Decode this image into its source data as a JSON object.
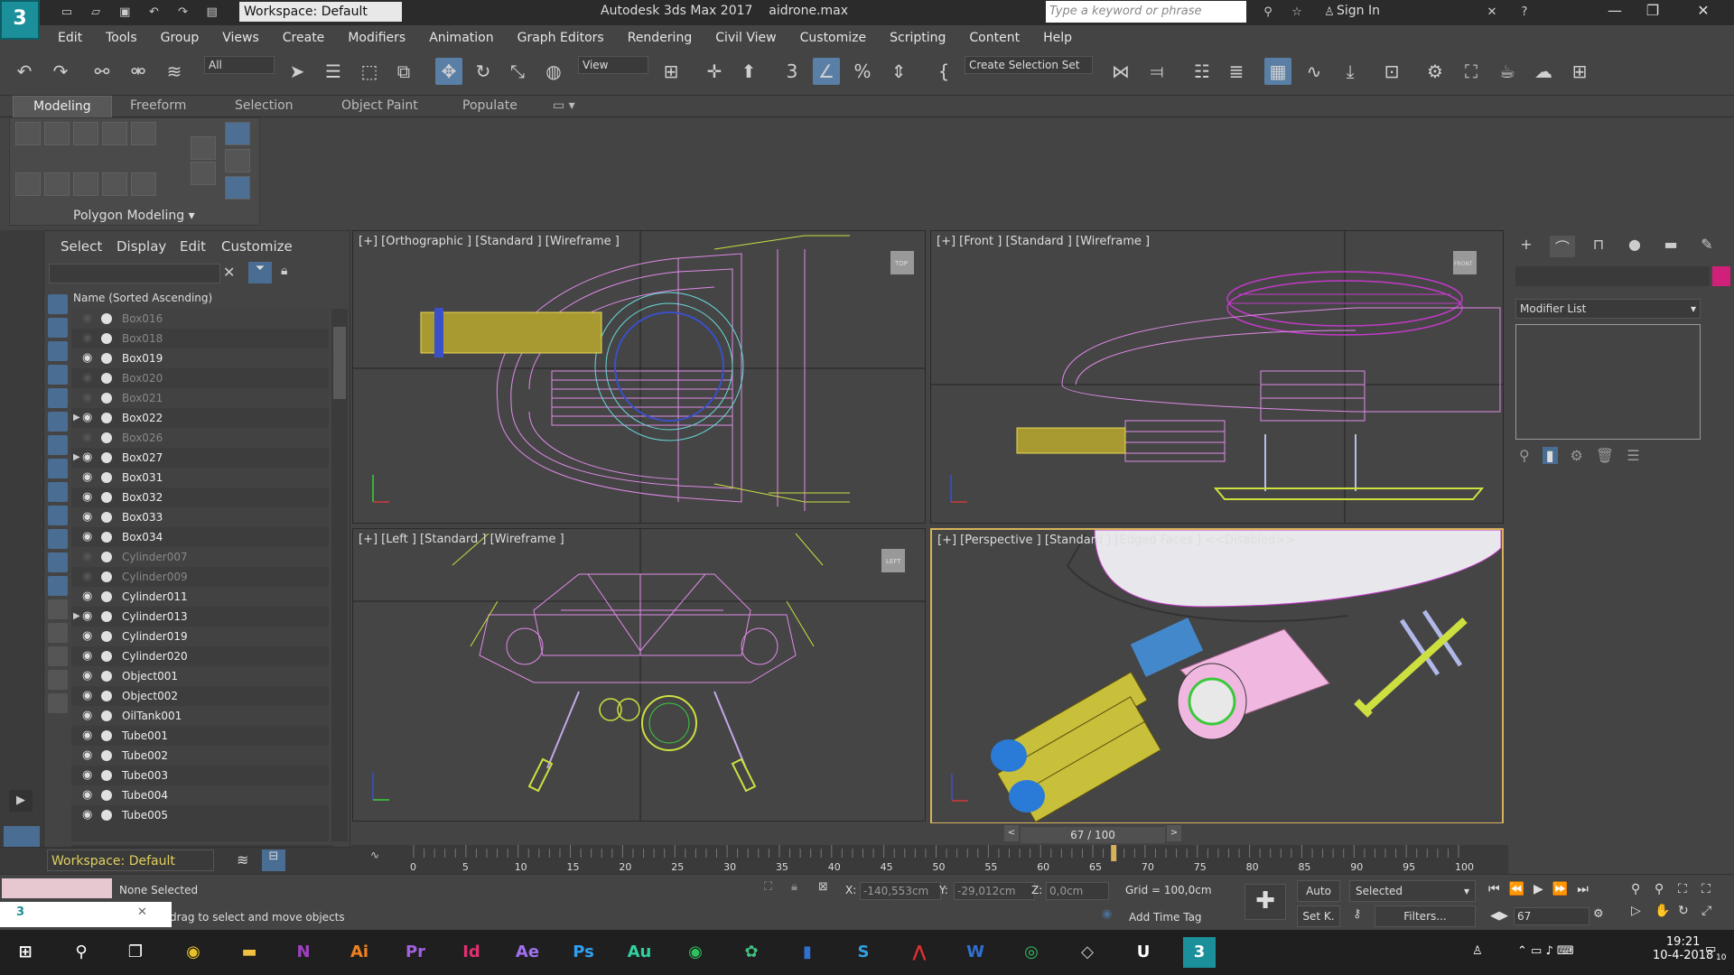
{
  "titlebar": {
    "logo": "3",
    "workspace": "Workspace: Default",
    "app_title": "Autodesk 3ds Max 2017",
    "file_name": "aidrone.max",
    "search_placeholder": "Type a keyword or phrase",
    "signin": "Sign In"
  },
  "menus": [
    "Edit",
    "Tools",
    "Group",
    "Views",
    "Create",
    "Modifiers",
    "Animation",
    "Graph Editors",
    "Rendering",
    "Civil View",
    "Customize",
    "Scripting",
    "Content",
    "Help"
  ],
  "toolbar": {
    "selection_filter": "All",
    "ref_coord": "View",
    "selection_set": "Create Selection Set"
  },
  "ribbon": {
    "tabs": [
      "Modeling",
      "Freeform",
      "Selection",
      "Object Paint",
      "Populate"
    ],
    "panel_label": "Polygon Modeling ▾"
  },
  "explorer": {
    "menus": [
      "Select",
      "Display",
      "Edit",
      "Customize"
    ],
    "header": "Name (Sorted Ascending)",
    "items": [
      {
        "name": "Box016",
        "hidden": true,
        "expand": false
      },
      {
        "name": "Box018",
        "hidden": true,
        "expand": false
      },
      {
        "name": "Box019",
        "hidden": false,
        "expand": false
      },
      {
        "name": "Box020",
        "hidden": true,
        "expand": false
      },
      {
        "name": "Box021",
        "hidden": true,
        "expand": false
      },
      {
        "name": "Box022",
        "hidden": false,
        "expand": true
      },
      {
        "name": "Box026",
        "hidden": true,
        "expand": false
      },
      {
        "name": "Box027",
        "hidden": false,
        "expand": true
      },
      {
        "name": "Box031",
        "hidden": false,
        "expand": false
      },
      {
        "name": "Box032",
        "hidden": false,
        "expand": false
      },
      {
        "name": "Box033",
        "hidden": false,
        "expand": false
      },
      {
        "name": "Box034",
        "hidden": false,
        "expand": false
      },
      {
        "name": "Cylinder007",
        "hidden": true,
        "expand": false
      },
      {
        "name": "Cylinder009",
        "hidden": true,
        "expand": false
      },
      {
        "name": "Cylinder011",
        "hidden": false,
        "expand": false
      },
      {
        "name": "Cylinder013",
        "hidden": false,
        "expand": true
      },
      {
        "name": "Cylinder019",
        "hidden": false,
        "expand": false
      },
      {
        "name": "Cylinder020",
        "hidden": false,
        "expand": false
      },
      {
        "name": "Object001",
        "hidden": false,
        "expand": false
      },
      {
        "name": "Object002",
        "hidden": false,
        "expand": false
      },
      {
        "name": "OilTank001",
        "hidden": false,
        "expand": false
      },
      {
        "name": "Tube001",
        "hidden": false,
        "expand": false
      },
      {
        "name": "Tube002",
        "hidden": false,
        "expand": false
      },
      {
        "name": "Tube003",
        "hidden": false,
        "expand": false
      },
      {
        "name": "Tube004",
        "hidden": false,
        "expand": false
      },
      {
        "name": "Tube005",
        "hidden": false,
        "expand": false
      }
    ],
    "workspace": "Workspace: Default"
  },
  "viewports": {
    "top_left": "[+] [Orthographic ] [Standard ] [Wireframe ]",
    "top_right": "[+] [Front ] [Standard ] [Wireframe ]",
    "bottom_left": "[+] [Left ] [Standard ] [Wireframe ]",
    "bottom_right": "[+] [Perspective ] [Standard ] [Edged Faces ]  <<Disabled>>",
    "cube_top": "TOP",
    "cube_front": "FRONT",
    "cube_left": "LEFT"
  },
  "command_panel": {
    "modifier_list": "Modifier List",
    "swatch_color": "#d0207a"
  },
  "timeline": {
    "frame_display": "67 / 100",
    "current_frame_fraction": 0.67,
    "ticks": [
      "0",
      "5",
      "10",
      "15",
      "20",
      "25",
      "30",
      "35",
      "40",
      "45",
      "50",
      "55",
      "60",
      "65",
      "70",
      "75",
      "80",
      "85",
      "90",
      "95",
      "100"
    ]
  },
  "status": {
    "selection": "None Selected",
    "prompt": "drag to select and move objects",
    "x_label": "X:",
    "x_value": "-140,553cm",
    "y_label": "Y:",
    "y_value": "-29,012cm",
    "z_label": "Z:",
    "z_value": "0,0cm",
    "grid": "Grid = 100,0cm",
    "add_time_tag": "Add Time Tag",
    "auto": "Auto",
    "set_key": "Set K.",
    "key_filter": "Selected",
    "filters": "Filters...",
    "frame": "67"
  },
  "taskbar": {
    "time": "19:21",
    "date": "10-4-2018",
    "notifications": "10"
  }
}
